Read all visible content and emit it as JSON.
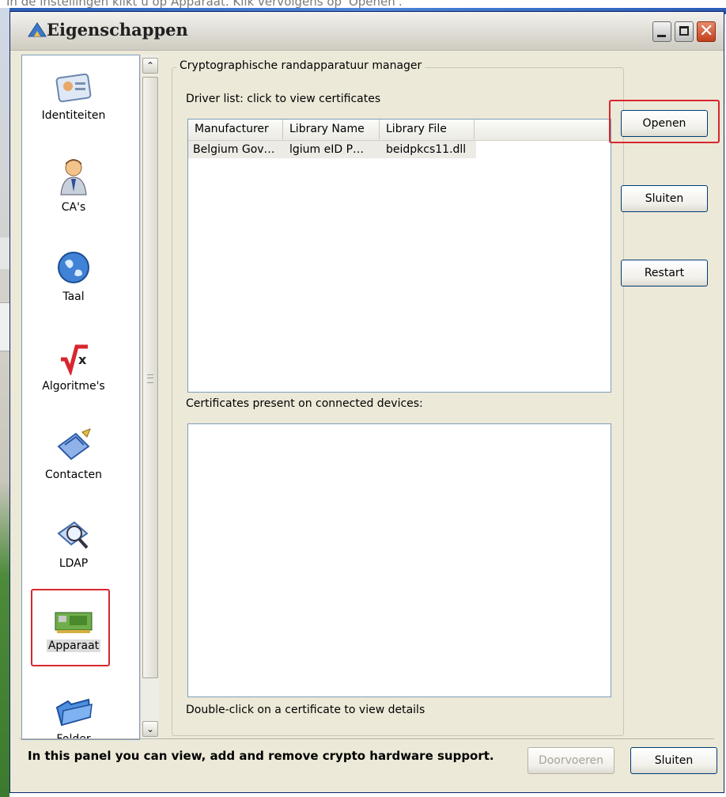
{
  "caption": "In de instellingen klikt u op Apparaat. Klik vervolgens op 'Openen'.",
  "window": {
    "title": "Eigenschappen",
    "controls": [
      "minimize-icon",
      "maximize-icon",
      "close-icon"
    ]
  },
  "sidebar": {
    "items": [
      {
        "label": "Identiteiten",
        "icon": "id-card-icon"
      },
      {
        "label": "CA's",
        "icon": "person-icon"
      },
      {
        "label": "Taal",
        "icon": "globe-icon"
      },
      {
        "label": "Algoritme's",
        "icon": "root-symbol-icon"
      },
      {
        "label": "Contacten",
        "icon": "contacts-icon"
      },
      {
        "label": "LDAP",
        "icon": "ldap-search-icon"
      },
      {
        "label": "Apparaat",
        "icon": "card-reader-icon",
        "selected": true
      },
      {
        "label": "Folder",
        "icon": "folder-icon"
      }
    ]
  },
  "main": {
    "group_title": "Cryptographische randapparatuur manager",
    "driver_list_label": "Driver list: click to view certificates",
    "driver_table": {
      "columns": [
        "Manufacturer",
        "Library Name",
        "Library File"
      ],
      "rows": [
        [
          "Belgium Gov…",
          "lgium eID P…",
          "beidpkcs11.dll"
        ]
      ]
    },
    "certificates_label": "Certificates present on connected devices:",
    "hint": "Double-click on a certificate to view details",
    "buttons": {
      "open": "Openen",
      "close": "Sluiten",
      "restart": "Restart"
    }
  },
  "footer": {
    "text": "In this panel you can view, add and remove crypto hardware support.",
    "apply": "Doorvoeren",
    "close": "Sluiten"
  },
  "colors": {
    "highlight": "#d8262e",
    "face": "#ece9d8",
    "border": "#7f9db9"
  }
}
